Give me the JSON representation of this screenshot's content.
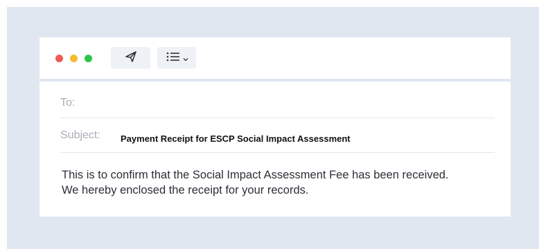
{
  "window": {
    "controls": [
      "close",
      "minimize",
      "maximize"
    ]
  },
  "toolbar": {
    "send_icon": "paper-plane-icon",
    "list_icon": "list-icon",
    "dropdown_icon": "chevron-down-icon"
  },
  "email": {
    "to_label": "To:",
    "to_value": "",
    "subject_label": "Subject:",
    "subject_value": "Payment Receipt for ESCP Social Impact Assessment",
    "body_line_1": "This is to confirm that the Social Impact Assessment Fee has been received.",
    "body_line_2": "We hereby enclosed the receipt for your records."
  },
  "colors": {
    "backdrop": "#e1e7f0",
    "close": "#ee5b53",
    "minimize": "#f4bb2a",
    "maximize": "#2ec44a"
  }
}
